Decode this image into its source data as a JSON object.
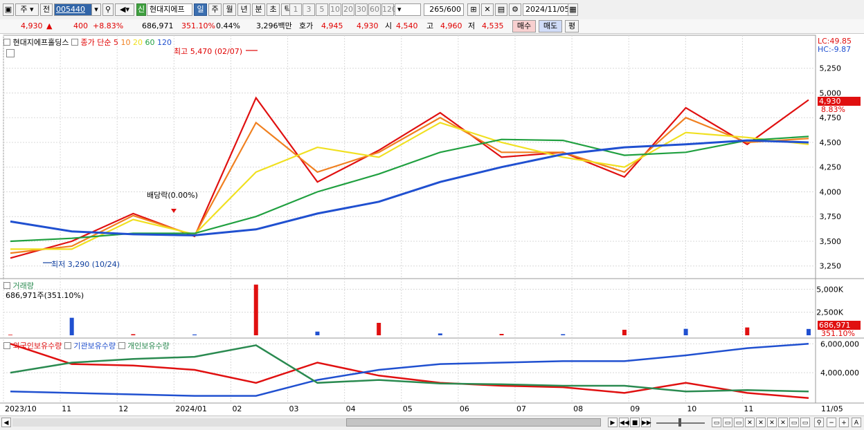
{
  "toolbar": {
    "period_select": "주",
    "prev_label": "전",
    "code": "005440",
    "badge": "신",
    "stock_name": "현대지에프",
    "tabs": [
      "일",
      "주",
      "월",
      "년",
      "분",
      "초",
      "틱"
    ],
    "active_tab": 0,
    "intervals": [
      "1",
      "3",
      "5",
      "10",
      "20",
      "30",
      "60",
      "120"
    ],
    "count": "265",
    "count_total": "/600",
    "date": "2024/11/05"
  },
  "quote": {
    "price": "4,930",
    "change_arrow": "▲",
    "change": "400",
    "change_pct": "+8.83%",
    "volume": "686,971",
    "volume_ratio": "351.10%",
    "turnover": "0.44%",
    "amount": "3,296백만",
    "hoga_label": "호가",
    "ask": "4,945",
    "bid": "4,930",
    "open_label": "시",
    "open": "4,540",
    "high_label": "고",
    "high": "4,960",
    "low_label": "저",
    "low": "4,535",
    "buy_label": "매수",
    "sell_label": "매도",
    "eval_label": "평"
  },
  "price_panel": {
    "stock_label": "현대지에프홀딩스",
    "ma_label": "종가 단순",
    "ma_periods": [
      "5",
      "10",
      "20",
      "60",
      "120"
    ],
    "ma_colors": [
      "#e01010",
      "#f08020",
      "#f0e020",
      "#20a040",
      "#2050d0"
    ],
    "lc": "LC:49.85",
    "hc": "HC:-9.87",
    "current_price": "4,930",
    "current_pct": "8.83%",
    "max_annotation": "최고 5,470 (02/07)",
    "min_annotation": "최저 3,290 (10/24)",
    "dividend_annotation": "배당락(0.00%)"
  },
  "volume_panel": {
    "title": "거래량",
    "value_line": "686,971주(351.10%)",
    "current_value": "686,971",
    "current_pct": "351.10%"
  },
  "holding_panel": {
    "series": [
      {
        "name": "외국인보유수량",
        "color": "#e01010"
      },
      {
        "name": "기관보유수량",
        "color": "#2050d0"
      },
      {
        "name": "개인보유수량",
        "color": "#2a8a50"
      }
    ]
  },
  "chart_data": [
    {
      "type": "line",
      "title": "현대지에프홀딩스",
      "series": [
        {
          "name": "5",
          "x": [
            "2023/10",
            "2023/11",
            "2023/12",
            "2024/01",
            "2024/02",
            "2024/03",
            "2024/04",
            "2024/05",
            "2024/06",
            "2024/07",
            "2024/08",
            "2024/09",
            "2024/10",
            "2024/11"
          ],
          "values": [
            3330,
            3500,
            3780,
            3550,
            4950,
            4100,
            4420,
            4800,
            4350,
            4400,
            4150,
            4850,
            4480,
            4930
          ]
        },
        {
          "name": "10",
          "x": [
            "2023/10",
            "2023/11",
            "2023/12",
            "2024/01",
            "2024/02",
            "2024/03",
            "2024/04",
            "2024/05",
            "2024/06",
            "2024/07",
            "2024/08",
            "2024/09",
            "2024/10",
            "2024/11"
          ],
          "values": [
            3380,
            3450,
            3760,
            3560,
            4700,
            4200,
            4400,
            4750,
            4400,
            4400,
            4200,
            4750,
            4500,
            4540
          ]
        },
        {
          "name": "20",
          "x": [
            "2023/10",
            "2023/11",
            "2023/12",
            "2024/01",
            "2024/02",
            "2024/03",
            "2024/04",
            "2024/05",
            "2024/06",
            "2024/07",
            "2024/08",
            "2024/09",
            "2024/10",
            "2024/11"
          ],
          "values": [
            3420,
            3420,
            3720,
            3570,
            4200,
            4450,
            4350,
            4700,
            4500,
            4350,
            4250,
            4600,
            4550,
            4480
          ]
        },
        {
          "name": "60",
          "x": [
            "2023/10",
            "2023/11",
            "2023/12",
            "2024/01",
            "2024/02",
            "2024/03",
            "2024/04",
            "2024/05",
            "2024/06",
            "2024/07",
            "2024/08",
            "2024/09",
            "2024/10",
            "2024/11"
          ],
          "values": [
            3500,
            3530,
            3580,
            3580,
            3750,
            4000,
            4180,
            4400,
            4530,
            4520,
            4370,
            4400,
            4520,
            4560
          ]
        },
        {
          "name": "120",
          "x": [
            "2023/10",
            "2023/11",
            "2023/12",
            "2024/01",
            "2024/02",
            "2024/03",
            "2024/04",
            "2024/05",
            "2024/06",
            "2024/07",
            "2024/08",
            "2024/09",
            "2024/10",
            "2024/11"
          ],
          "values": [
            3700,
            3600,
            3570,
            3560,
            3620,
            3780,
            3900,
            4100,
            4250,
            4380,
            4450,
            4480,
            4520,
            4500
          ]
        }
      ],
      "ylim": [
        3150,
        5500
      ],
      "yticks": [
        3250,
        3500,
        3750,
        4000,
        4250,
        4500,
        4750,
        5000,
        5250
      ]
    },
    {
      "type": "bar",
      "title": "거래량",
      "categories": [
        "2023/10",
        "2023/11",
        "2023/12",
        "2024/01",
        "2024/02",
        "2024/03",
        "2024/04",
        "2024/05",
        "2024/06",
        "2024/07",
        "2024/08",
        "2024/09",
        "2024/10",
        "2024/11"
      ],
      "values": [
        60000,
        1900000,
        120000,
        90000,
        5500000,
        400000,
        1350000,
        200000,
        150000,
        120000,
        600000,
        700000,
        850000,
        686971
      ],
      "ylim": [
        0,
        6000000
      ],
      "yticks": [
        "2,500K",
        "5,000K"
      ]
    },
    {
      "type": "line",
      "title": "보유수량",
      "series": [
        {
          "name": "외국인보유수량",
          "x": [
            "2023/10",
            "2023/11",
            "2023/12",
            "2024/01",
            "2024/02",
            "2024/03",
            "2024/04",
            "2024/05",
            "2024/06",
            "2024/07",
            "2024/08",
            "2024/09",
            "2024/10",
            "2024/11"
          ],
          "values": [
            6000000,
            4600000,
            4500000,
            4200000,
            3300000,
            4700000,
            3800000,
            3300000,
            3100000,
            3000000,
            2600000,
            3300000,
            2600000,
            2250000
          ]
        },
        {
          "name": "기관보유수량",
          "x": [
            "2023/10",
            "2023/11",
            "2023/12",
            "2024/01",
            "2024/02",
            "2024/03",
            "2024/04",
            "2024/05",
            "2024/06",
            "2024/07",
            "2024/08",
            "2024/09",
            "2024/10",
            "2024/11"
          ],
          "values": [
            2700000,
            2600000,
            2500000,
            2400000,
            2400000,
            3500000,
            4200000,
            4600000,
            4700000,
            4800000,
            4800000,
            5200000,
            5700000,
            6000000
          ]
        },
        {
          "name": "개인보유수량",
          "x": [
            "2023/10",
            "2023/11",
            "2023/12",
            "2024/01",
            "2024/02",
            "2024/03",
            "2024/04",
            "2024/05",
            "2024/06",
            "2024/07",
            "2024/08",
            "2024/09",
            "2024/10",
            "2024/11"
          ],
          "values": [
            4000000,
            4700000,
            4950000,
            5100000,
            5900000,
            3300000,
            3500000,
            3250000,
            3200000,
            3100000,
            3100000,
            2700000,
            2800000,
            2700000
          ]
        }
      ],
      "yticks": [
        "4,000,000",
        "6,000,000"
      ]
    }
  ],
  "x_axis": {
    "labels": [
      "2023/10",
      "11",
      "12",
      "2024/01",
      "02",
      "03",
      "04",
      "05",
      "06",
      "07",
      "08",
      "09",
      "10",
      "11",
      "11/05"
    ]
  },
  "scrollbar": {
    "nav_buttons": [
      "▶",
      "◀◀",
      "■",
      "▶▶"
    ]
  }
}
